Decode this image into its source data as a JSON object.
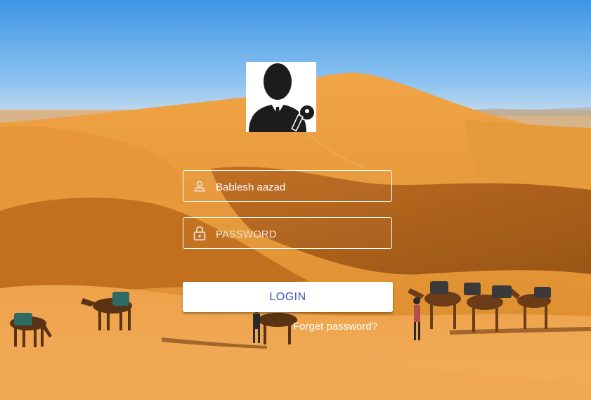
{
  "login": {
    "avatar_icon": "user-with-key-icon",
    "username_icon": "person-icon",
    "username_value": "Bablesh aazad",
    "password_icon": "lock-icon",
    "password_placeholder": "PASSWORD",
    "login_label": "LOGIN",
    "forget_label": "Forget password?"
  },
  "colors": {
    "button_text": "#3f51b5",
    "sky": "#4a9be6",
    "sand": "#e3952f"
  }
}
